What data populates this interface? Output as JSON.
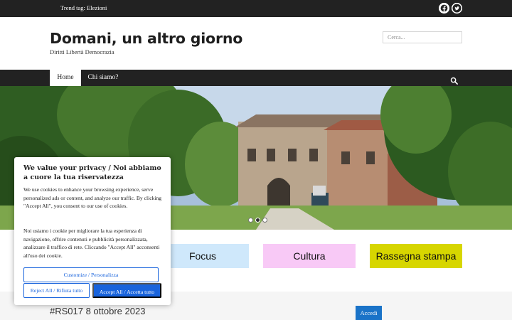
{
  "topbar": {
    "trend_text": "Trend tag: Elezioni",
    "social": [
      {
        "icon": "facebook-icon"
      },
      {
        "icon": "twitter-icon"
      }
    ]
  },
  "header": {
    "title": "Domani, un altro giorno",
    "tagline": "Diritti Libertà Democrazia",
    "search": {
      "placeholder": "Cerca...",
      "value": ""
    }
  },
  "nav": {
    "items": [
      {
        "label": "Home",
        "active": true
      },
      {
        "label": "Chi siamo?",
        "active": false
      }
    ],
    "search_icon": "search-icon"
  },
  "slider": {
    "slide_count": 3,
    "active_slide": 2
  },
  "categories": [
    {
      "label": "Focus",
      "color": "#cfe8fb"
    },
    {
      "label": "Cultura",
      "color": "#f8c9f6"
    },
    {
      "label": "Rassegna stampa",
      "color": "#d7d600"
    }
  ],
  "post": {
    "title": "#RS017 8 ottobre 2023"
  },
  "login_button": {
    "label": "Accedi"
  },
  "cookie_banner": {
    "title": "We value your privacy / Noi abbiamo a cuore la tua riservatezza",
    "text_en": "We use cookies to enhance your browsing experience, serve personalized ads or content, and analyze our traffic. By clicking \"Accept All\", you consent to our use of cookies.",
    "text_it": "Noi usiamo i cookie per migliorare la tua esperienza di navigazione, offrire contenuti e pubblicità personalizzata, analizzare il traffico di rete. Cliccando \"Accept All\" acconsenti all'uso dei cookie.",
    "customize_label": "Customize / Personalizza",
    "reject_label": "Reject All / Rifiuta tutto",
    "accept_label": "Accept All / Accetta tutto",
    "accent_color": "#1863dc"
  }
}
